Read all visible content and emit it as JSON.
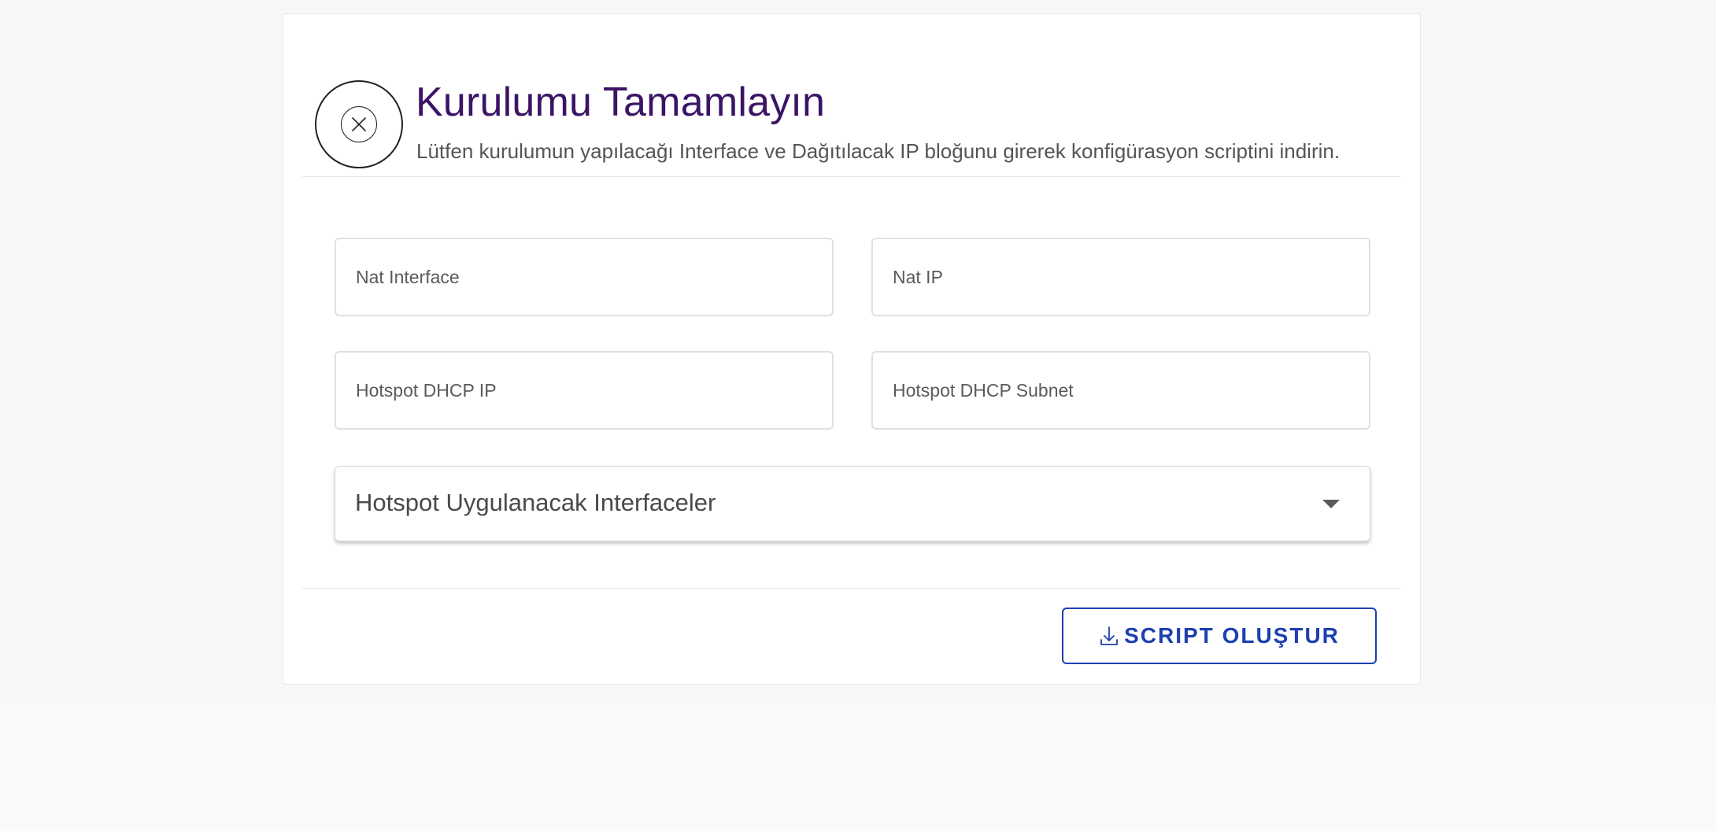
{
  "header": {
    "title": "Kurulumu Tamamlayın",
    "subtitle": "Lütfen kurulumun yapılacağı Interface ve Dağıtılacak IP bloğunu girerek konfigürasyon scriptini indirin.",
    "icon": "close-circle-icon"
  },
  "form": {
    "nat_interface": {
      "placeholder": "Nat Interface",
      "value": ""
    },
    "nat_ip": {
      "placeholder": "Nat IP",
      "value": ""
    },
    "hotspot_dhcp_ip": {
      "placeholder": "Hotspot DHCP IP",
      "value": ""
    },
    "hotspot_dhcp_subnet": {
      "placeholder": "Hotspot DHCP Subnet",
      "value": ""
    },
    "hotspot_interfaces": {
      "label": "Hotspot Uygulanacak Interfaceler",
      "icon": "caret-down-icon"
    }
  },
  "actions": {
    "script_button": {
      "label": "SCRIPT OLUŞTUR",
      "icon": "download-icon"
    }
  },
  "colors": {
    "title": "#3b1466",
    "accent": "#1d40b0",
    "border": "#e0e0e4"
  }
}
